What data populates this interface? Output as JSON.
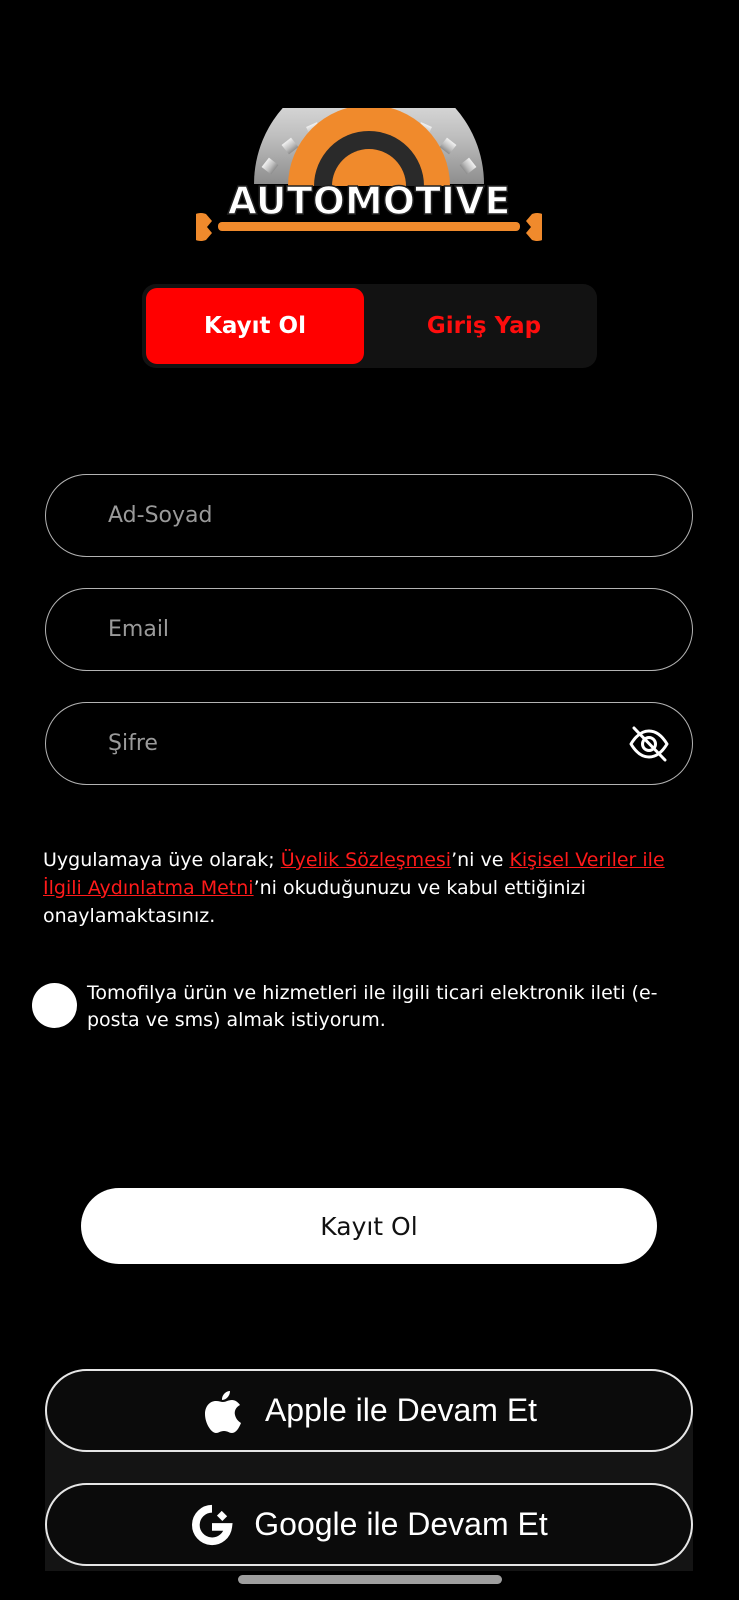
{
  "logo": {
    "text": "AUTOMOTIVE"
  },
  "tabs": {
    "register": "Kayıt Ol",
    "login": "Giriş Yap"
  },
  "form": {
    "name_placeholder": "Ad-Soyad",
    "email_placeholder": "Email",
    "password_placeholder": "Şifre"
  },
  "consent": {
    "prefix": "Uygulamaya üye olarak; ",
    "link1": "Üyelik Sözleşmesi",
    "mid": "’ni ve ",
    "link2": "Kişisel Veriler ile İlgili Aydınlatma Metni",
    "suffix": "’ni okuduğunuzu ve kabul ettiğinizi onaylamaktasınız."
  },
  "optin": {
    "text": "Tomofilya ürün ve hizmetleri ile ilgili ticari elektronik ileti (e-posta ve sms) almak istiyorum."
  },
  "submit": {
    "label": "Kayıt Ol"
  },
  "social": {
    "apple": "Apple ile Devam Et",
    "google": "Google ile Devam Et"
  },
  "colors": {
    "accent": "#ff0000",
    "background": "#000000",
    "logo_orange": "#f08a2c"
  }
}
